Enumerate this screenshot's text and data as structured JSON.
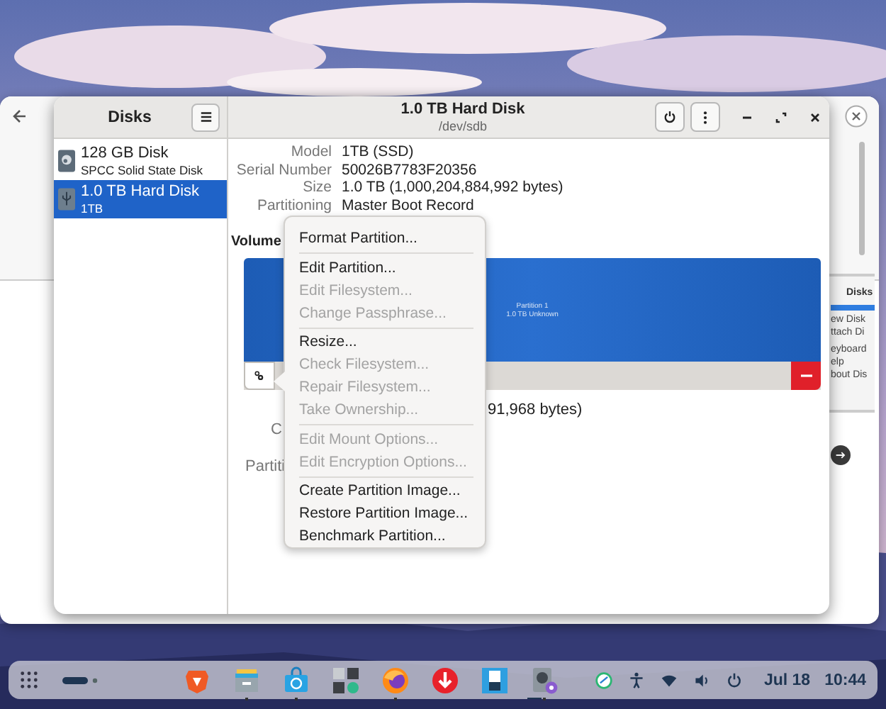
{
  "background_window": {
    "side_menu": {
      "title": "Disks",
      "items": [
        "ew Disk",
        "ttach Di",
        "eyboard",
        "elp",
        "bout Dis"
      ]
    }
  },
  "disks_window": {
    "sidebar": {
      "title": "Disks",
      "items": [
        {
          "name": "128 GB Disk",
          "subtitle": "SPCC Solid State Disk",
          "kind": "ssd",
          "selected": false
        },
        {
          "name": "1.0 TB Hard Disk",
          "subtitle": "1TB",
          "kind": "usb",
          "selected": true
        }
      ]
    },
    "header": {
      "title": "1.0 TB Hard Disk",
      "subtitle": "/dev/sdb"
    },
    "details": [
      {
        "label": "Model",
        "value": "1TB (SSD)"
      },
      {
        "label": "Serial Number",
        "value": "50026B7783F20356"
      },
      {
        "label": "Size",
        "value": "1.0 TB (1,000,204,884,992 bytes)"
      },
      {
        "label": "Partitioning",
        "value": "Master Boot Record"
      }
    ],
    "volumes_heading": "Volume",
    "volume": {
      "name": "Partition 1",
      "info": "1.0 TB Unknown"
    },
    "volume_details_visible": {
      "size_value_end": "91,968 bytes)",
      "contents_label_start": "C",
      "partition_label_start": "Partiti"
    },
    "context_menu": {
      "items": [
        {
          "kind": "item",
          "label": "Format Partition...",
          "disabled": false
        },
        {
          "kind": "separator"
        },
        {
          "kind": "item",
          "label": "Edit Partition...",
          "disabled": false
        },
        {
          "kind": "item",
          "label": "Edit Filesystem...",
          "disabled": true
        },
        {
          "kind": "item",
          "label": "Change Passphrase...",
          "disabled": true
        },
        {
          "kind": "separator"
        },
        {
          "kind": "item",
          "label": "Resize...",
          "disabled": false
        },
        {
          "kind": "item",
          "label": "Check Filesystem...",
          "disabled": true
        },
        {
          "kind": "item",
          "label": "Repair Filesystem...",
          "disabled": true
        },
        {
          "kind": "item",
          "label": "Take Ownership...",
          "disabled": true
        },
        {
          "kind": "separator"
        },
        {
          "kind": "item",
          "label": "Edit Mount Options...",
          "disabled": true
        },
        {
          "kind": "item",
          "label": "Edit Encryption Options...",
          "disabled": true
        },
        {
          "kind": "separator"
        },
        {
          "kind": "item",
          "label": "Create Partition Image...",
          "disabled": false
        },
        {
          "kind": "item",
          "label": "Restore Partition Image...",
          "disabled": false
        },
        {
          "kind": "item",
          "label": "Benchmark Partition...",
          "disabled": false
        }
      ]
    }
  },
  "taskbar": {
    "apps": [
      {
        "kind": "shield",
        "running": false,
        "focused": false
      },
      {
        "kind": "files",
        "running": true,
        "focused": false
      },
      {
        "kind": "store",
        "running": true,
        "focused": false
      },
      {
        "kind": "calculator",
        "running": false,
        "focused": false
      },
      {
        "kind": "firefox",
        "running": true,
        "focused": false
      },
      {
        "kind": "downloader",
        "running": false,
        "focused": false
      },
      {
        "kind": "usb",
        "running": false,
        "focused": false
      },
      {
        "kind": "disks",
        "running": true,
        "focused": true
      }
    ],
    "date": "Jul 18",
    "time": "10:44"
  }
}
